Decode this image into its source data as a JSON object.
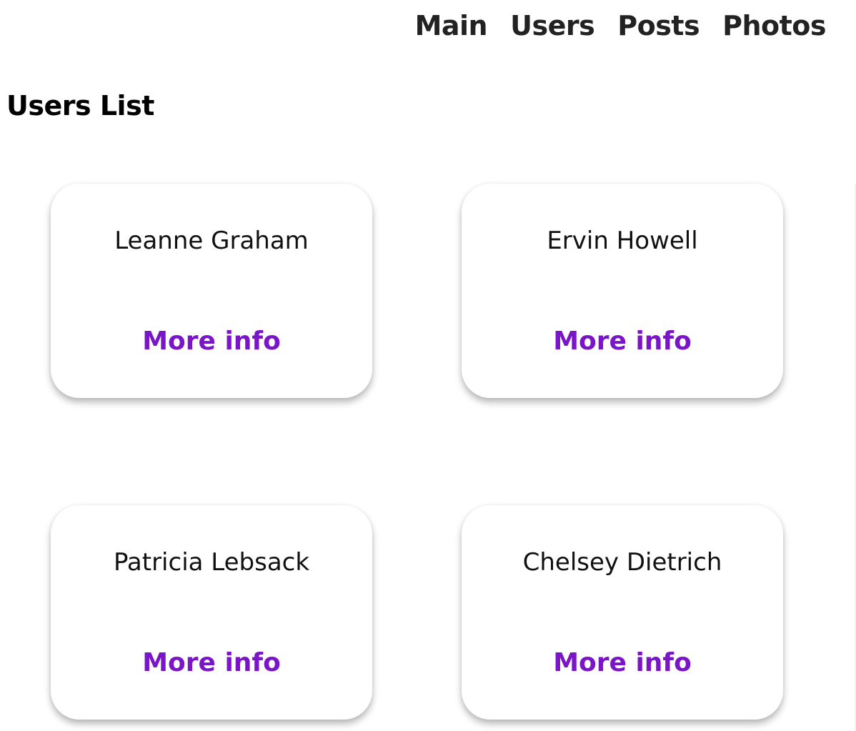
{
  "nav": {
    "items": [
      {
        "label": "Main"
      },
      {
        "label": "Users"
      },
      {
        "label": "Posts"
      },
      {
        "label": "Photos"
      }
    ]
  },
  "page": {
    "title": "Users List"
  },
  "users": [
    {
      "name": "Leanne Graham",
      "link_label": "More info"
    },
    {
      "name": "Ervin Howell",
      "link_label": "More info"
    },
    {
      "name": "Patricia Lebsack",
      "link_label": "More info"
    },
    {
      "name": "Chelsey Dietrich",
      "link_label": "More info"
    }
  ],
  "colors": {
    "link": "#7a16c8",
    "nav_text": "#222222",
    "background": "#ffffff"
  }
}
